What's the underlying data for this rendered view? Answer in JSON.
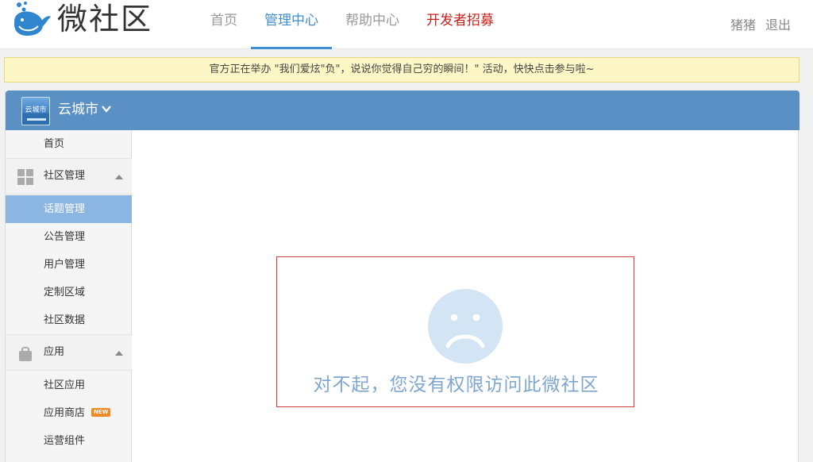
{
  "header": {
    "logo_text": "微社区",
    "nav": [
      {
        "label": "首页",
        "state": "normal"
      },
      {
        "label": "管理中心",
        "state": "active"
      },
      {
        "label": "帮助中心",
        "state": "normal"
      },
      {
        "label": "开发者招募",
        "state": "highlight"
      }
    ],
    "user_name": "猪猪",
    "logout_label": "退出",
    "accent_color": "#3f8fd0",
    "highlight_color": "#c9201c"
  },
  "notice": {
    "text": "官方正在举办 \"我们爱炫\"负\"，说说你觉得自己穷的瞬间！\" 活动，快快点击参与啦~"
  },
  "community": {
    "logo_text": "云城市",
    "name": "云城市",
    "header_color": "#5b90c5"
  },
  "sidebar": {
    "home": "首页",
    "groups": [
      {
        "label": "社区管理",
        "icon": "grid-icon",
        "items": [
          "话题管理",
          "公告管理",
          "用户管理",
          "定制区域",
          "社区数据"
        ],
        "selected": "话题管理"
      },
      {
        "label": "应用",
        "icon": "bag-icon",
        "items": [
          "社区应用",
          "应用商店",
          "运营组件"
        ],
        "badge": "NEW"
      }
    ]
  },
  "error": {
    "icon": "sad-face-icon",
    "message": "对不起，您没有权限访问此微社区"
  }
}
